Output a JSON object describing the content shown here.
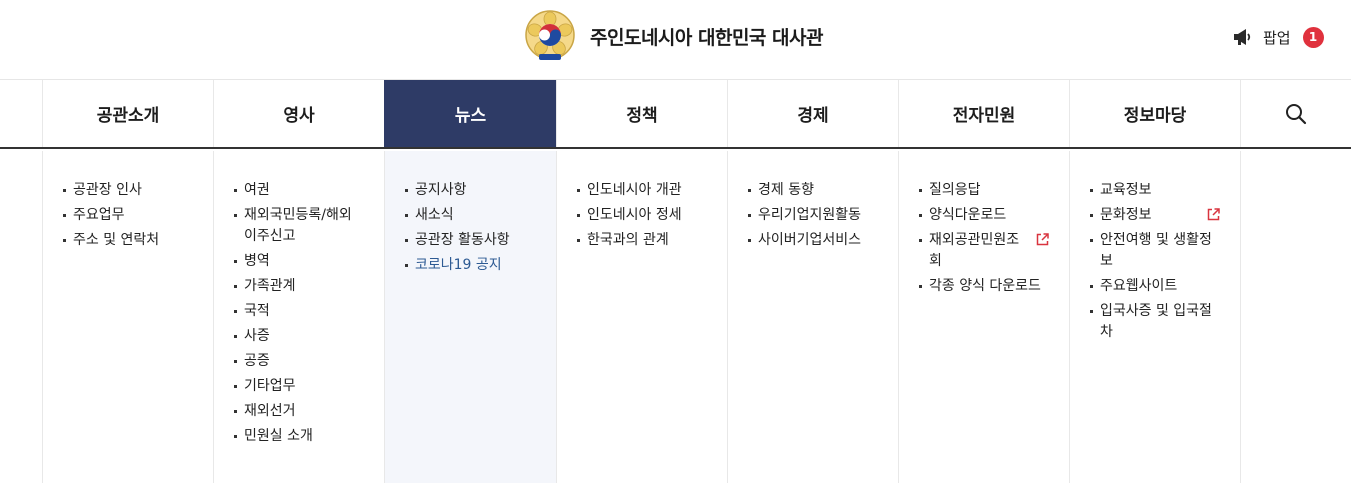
{
  "header": {
    "site_title": "주인도네시아 대한민국 대사관",
    "popup_label": "팝업",
    "popup_count": "1"
  },
  "gnb": {
    "items": [
      {
        "label": "공관소개"
      },
      {
        "label": "영사"
      },
      {
        "label": "뉴스",
        "active": true
      },
      {
        "label": "정책"
      },
      {
        "label": "경제"
      },
      {
        "label": "전자민원"
      },
      {
        "label": "정보마당"
      }
    ],
    "search_icon": "search-icon"
  },
  "submenu": {
    "col0": [
      "공관장 인사",
      "주요업무",
      "주소 및 연락처"
    ],
    "col1": [
      "여권",
      "재외국민등록/해외이주신고",
      "병역",
      "가족관계",
      "국적",
      "사증",
      "공증",
      "기타업무",
      "재외선거",
      "민원실 소개"
    ],
    "col2": [
      "공지사항",
      "새소식",
      "공관장 활동사항",
      "코로나19 공지"
    ],
    "col3": [
      "인도네시아 개관",
      "인도네시아 정세",
      "한국과의 관계"
    ],
    "col4": [
      "경제 동향",
      "우리기업지원활동",
      "사이버기업서비스"
    ],
    "col5": [
      "질의응답",
      "양식다운로드",
      "재외공관민원조회",
      "각종 양식 다운로드"
    ],
    "col6": [
      "교육정보",
      "문화정보",
      "안전여행 및 생활정보",
      "주요웹사이트",
      "입국사증 및 입국절차"
    ]
  },
  "colors": {
    "active_nav": "#2e3b66",
    "badge": "#e0313d",
    "external_link": "#d9343f",
    "highlight_link": "#2d5a93"
  }
}
